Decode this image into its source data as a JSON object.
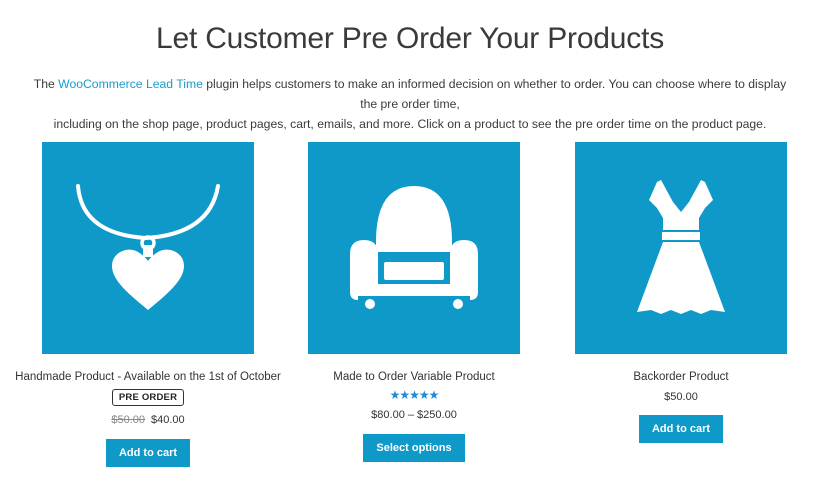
{
  "header": {
    "title": "Let Customer Pre Order Your Products"
  },
  "intro": {
    "prefix": "The ",
    "link_text": "WooCommerce Lead Time",
    "line1_rest": " plugin helps customers to make an informed decision on whether to order. You can choose where to display the pre order time,",
    "line2": "including on the shop page, product pages, cart, emails, and more. Click on a product to see the pre order time on the product page."
  },
  "colors": {
    "accent": "#0e99c9",
    "link": "#1a9ccc",
    "stars": "#1f8bd6"
  },
  "products": [
    {
      "name": "Handmade Product - Available on the 1st of October",
      "icon": "heart-necklace-icon",
      "badge": "PRE ORDER",
      "old_price": "$50.00",
      "price": "$40.00",
      "button": "Add to cart"
    },
    {
      "name": "Made to Order Variable Product",
      "icon": "armchair-icon",
      "rating": "★★★★★",
      "rating_value": 5,
      "price": "$80.00 – $250.00",
      "button": "Select options"
    },
    {
      "name": "Backorder Product",
      "icon": "dress-icon",
      "price": "$50.00",
      "button": "Add to cart"
    }
  ]
}
